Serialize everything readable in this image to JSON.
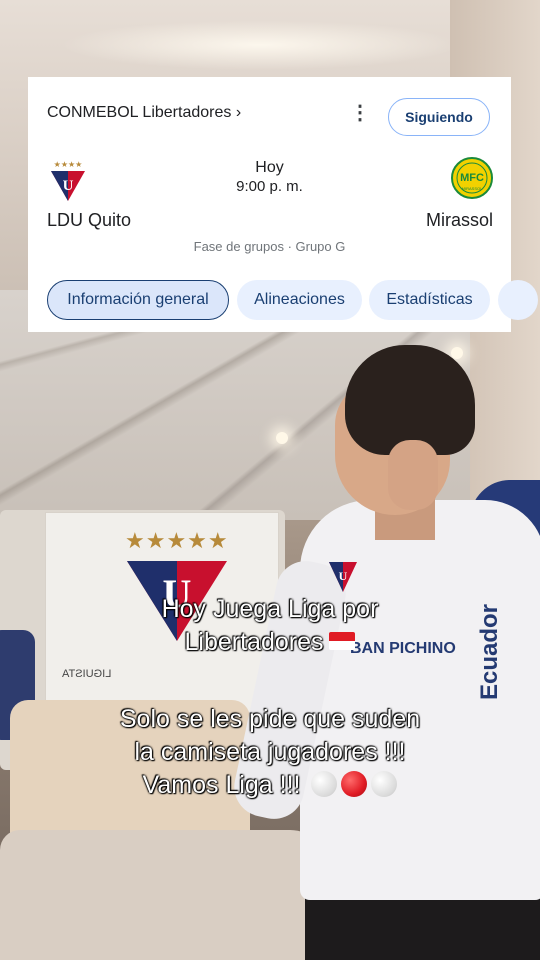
{
  "card": {
    "league": "CONMEBOL Libertadores ›",
    "more_icon": "⋮",
    "follow_label": "Siguiendo",
    "home_team": "LDU Quito",
    "away_team": "Mirassol",
    "day": "Hoy",
    "time": "9:00 p. m.",
    "stage": "Fase de grupos · Grupo G",
    "tabs": [
      {
        "label": "Información general",
        "active": true
      },
      {
        "label": "Alineaciones",
        "active": false
      },
      {
        "label": "Estadísticas",
        "active": false
      }
    ],
    "home_logo_stars": "★★★★",
    "away_logo_text": "MFC",
    "away_logo_subtext": "MIRASSOL"
  },
  "captions": {
    "line1": "Hoy Juega Liga por",
    "line2": "Libertadores",
    "line3": "Solo se les pide que suden",
    "line4": "la camiseta jugadores !!!",
    "line5": "Vamos Liga !!!"
  },
  "scene": {
    "banner_stars": "★★★★★",
    "banner_text": "LIGUISTA",
    "sponsor_text_1": "BAN PICHINO",
    "sponsor_text_2": "Ecuador"
  },
  "colors": {
    "accent": "#1a3f72",
    "tab_bg": "#e8f0fe",
    "ldu_red": "#c8102e",
    "ldu_navy": "#1f2f6b",
    "mirassol_yellow": "#f2d100",
    "mirassol_green": "#1b8a3a"
  }
}
